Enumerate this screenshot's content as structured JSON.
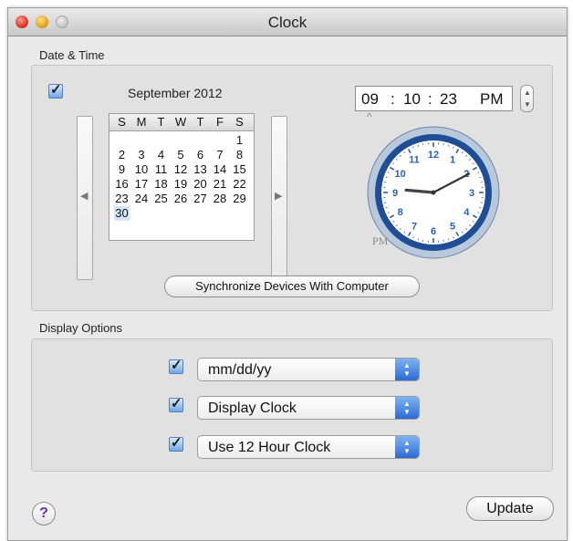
{
  "window": {
    "title": "Clock"
  },
  "date_time": {
    "section_label": "Date & Time",
    "enabled_checked": true,
    "month_label": "September 2012",
    "weekday_headers": [
      "S",
      "M",
      "T",
      "W",
      "T",
      "F",
      "S"
    ],
    "calendar_rows": [
      [
        "",
        "",
        "",
        "",
        "",
        "",
        "1"
      ],
      [
        "2",
        "3",
        "4",
        "5",
        "6",
        "7",
        "8"
      ],
      [
        "9",
        "10",
        "11",
        "12",
        "13",
        "14",
        "15"
      ],
      [
        "16",
        "17",
        "18",
        "19",
        "20",
        "21",
        "22"
      ],
      [
        "23",
        "24",
        "25",
        "26",
        "27",
        "28",
        "29"
      ],
      [
        "30",
        "",
        "",
        "",
        "",
        "",
        ""
      ]
    ],
    "selected_day": "30",
    "prev_icon": "left-arrow-icon",
    "next_icon": "right-arrow-icon",
    "time": {
      "hours": "09",
      "sep1": ":",
      "minutes": "10",
      "sep2": ":",
      "seconds": "23",
      "ampm": "PM"
    },
    "clock": {
      "hour": 9,
      "minute": 10,
      "second": 23,
      "pm_label": "PM",
      "numbers": [
        "12",
        "1",
        "2",
        "3",
        "4",
        "5",
        "6",
        "7",
        "8",
        "9",
        "10",
        "11"
      ]
    },
    "sync_button_label": "Synchronize Devices With Computer"
  },
  "display_options": {
    "section_label": "Display Options",
    "rows": [
      {
        "checked": true,
        "value": "mm/dd/yy"
      },
      {
        "checked": true,
        "value": "Display Clock"
      },
      {
        "checked": true,
        "value": "Use 12 Hour Clock"
      }
    ]
  },
  "footer": {
    "help_label": "?",
    "update_label": "Update"
  },
  "colors": {
    "accent": "#2b6ad4",
    "clock_numbers": "#2a5fb8",
    "help_mark": "#6b2fb7"
  }
}
